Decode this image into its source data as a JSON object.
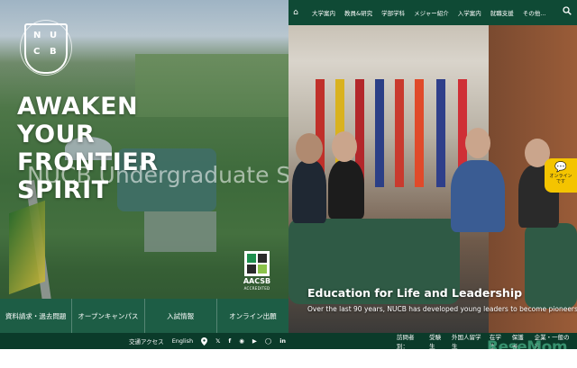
{
  "hero": {
    "headline": [
      "AWAKEN",
      "YOUR",
      "FRONTIER",
      "SPIRIT"
    ],
    "subtitle": "NUCB Undergraduate School",
    "crest_letters": [
      "N",
      "U",
      "C",
      "B"
    ],
    "badge_name": "AACSB",
    "badge_subtitle": "ACCREDITED"
  },
  "quick_links": [
    "資料請求・過去問題",
    "オープンキャンパス",
    "入試情報",
    "オンライン出願"
  ],
  "top_nav": {
    "items": [
      "大学案内",
      "教員&研究",
      "学部学科",
      "メジャー紹介",
      "入学案内",
      "就職支援",
      "その他..."
    ],
    "icons": [
      "home-icon",
      "search-icon"
    ]
  },
  "feature": {
    "title": "Education for Life and Leadership",
    "subtitle": "Over the last 90 years, NUCB has developed young leaders to become pioneers."
  },
  "online_button": {
    "label": [
      "オンライン",
      "です"
    ],
    "icon": "chat-bubble-icon",
    "color": "#f4c400"
  },
  "footer": {
    "left_links": [
      "交通アクセス",
      "English"
    ],
    "social_icons": [
      "map-pin-icon",
      "x-icon",
      "facebook-icon",
      "line-icon",
      "youtube-icon",
      "instagram-icon",
      "linkedin-icon"
    ],
    "visitor_label": "訪問者別：",
    "visitor_links": [
      "受験生",
      "外国人留学生",
      "在学生",
      "保護者",
      "企業・一般の方"
    ]
  },
  "watermark": "ReseMom",
  "colors": {
    "brand_green": "#0f4a35",
    "quick_bar": "#1d5d45"
  }
}
